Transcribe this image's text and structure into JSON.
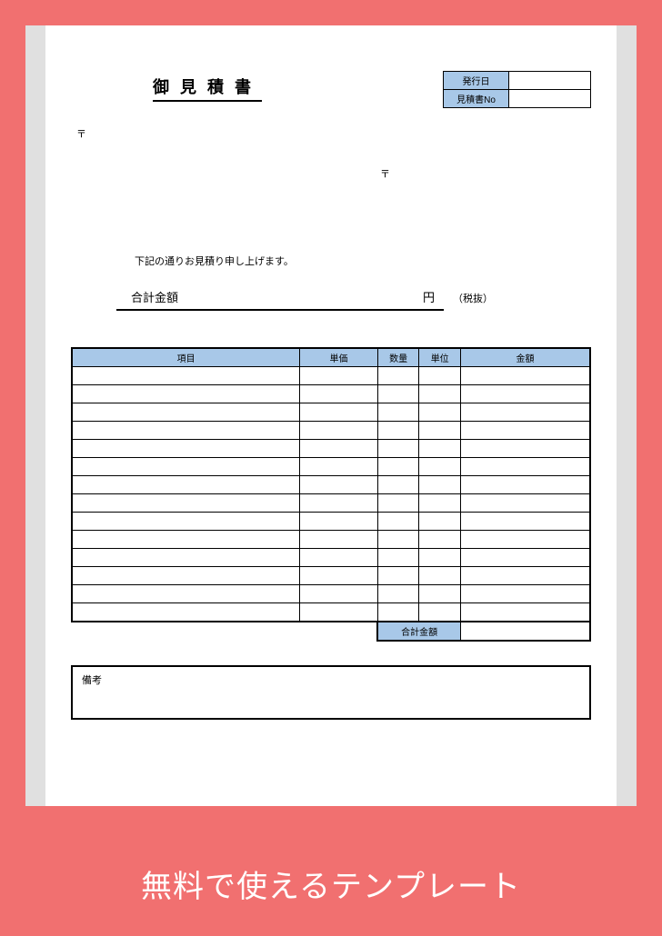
{
  "title": "御見積書",
  "meta": {
    "issue_date_label": "発行日",
    "issue_date_value": "",
    "quote_no_label": "見積書No",
    "quote_no_value": ""
  },
  "postal_mark_left": "〒",
  "postal_mark_right": "〒",
  "intro_text": "下記の通りお見積り申し上げます。",
  "total": {
    "label": "合計金額",
    "currency": "円",
    "tax_note": "（税抜）"
  },
  "items_header": {
    "item": "項目",
    "unit_price": "単価",
    "qty": "数量",
    "unit": "単位",
    "amount": "金額"
  },
  "items_row_count": 14,
  "items_sum_label": "合計金額",
  "items_sum_value": "",
  "notes_label": "備考",
  "banner_text": "無料で使えるテンプレート",
  "colors": {
    "frame": "#f17070",
    "header_cell": "#a8c8e8"
  }
}
